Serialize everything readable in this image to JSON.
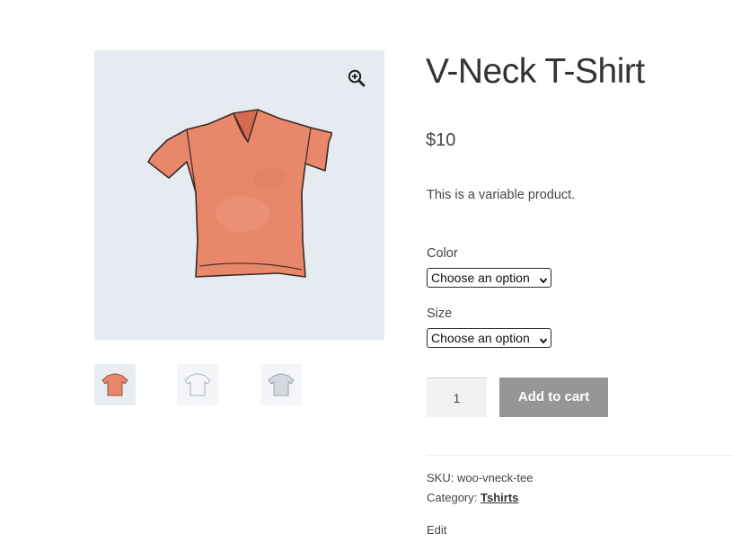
{
  "product": {
    "title": "V-Neck T-Shirt",
    "price": "$10",
    "description": "This is a variable product."
  },
  "gallery": {
    "zoom_icon": "magnifier-plus-icon",
    "thumbnails": [
      {
        "label": "Orange shirt",
        "color": "#e8876a"
      },
      {
        "label": "White shirt",
        "color": "#f0f2f5"
      },
      {
        "label": "Grey shirt",
        "color": "#d5d9df"
      }
    ]
  },
  "variations": {
    "color_label": "Color",
    "color_value": "Choose an option",
    "size_label": "Size",
    "size_value": "Choose an option"
  },
  "cart": {
    "quantity": "1",
    "add_label": "Add to cart"
  },
  "meta": {
    "sku_label": "SKU:",
    "sku_value": "woo-vneck-tee",
    "category_label": "Category:",
    "category_value": "Tshirts",
    "edit_label": "Edit"
  },
  "colors": {
    "shirt": "#e8876a",
    "button": "#969696",
    "gallery_bg": "#e6ebf1"
  }
}
